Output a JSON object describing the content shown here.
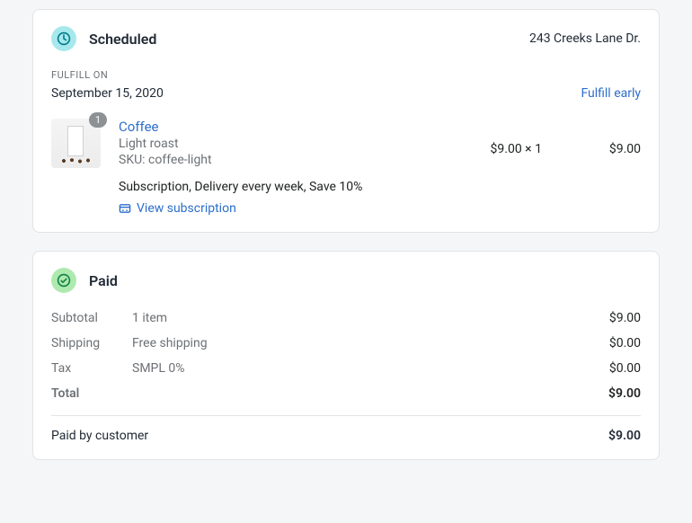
{
  "scheduled": {
    "title": "Scheduled",
    "address": "243 Creeks Lane Dr.",
    "fulfill_label": "FULFILL ON",
    "fulfill_date": "September 15, 2020",
    "fulfill_early": "Fulfill early"
  },
  "line_item": {
    "qty_badge": "1",
    "title": "Coffee",
    "variant": "Light roast",
    "sku_label": "SKU: coffee-light",
    "unit_price": "$9.00 × 1",
    "line_total": "$9.00",
    "subscription_desc": "Subscription, Delivery every week, Save 10%",
    "view_subscription": "View subscription"
  },
  "paid": {
    "title": "Paid",
    "rows": {
      "subtotal": {
        "label": "Subtotal",
        "mid": "1 item",
        "amount": "$9.00"
      },
      "shipping": {
        "label": "Shipping",
        "mid": "Free shipping",
        "amount": "$0.00"
      },
      "tax": {
        "label": "Tax",
        "mid": "SMPL 0%",
        "amount": "$0.00"
      },
      "total": {
        "label": "Total",
        "amount": "$9.00"
      }
    },
    "paid_by_customer": {
      "label": "Paid by customer",
      "amount": "$9.00"
    }
  }
}
